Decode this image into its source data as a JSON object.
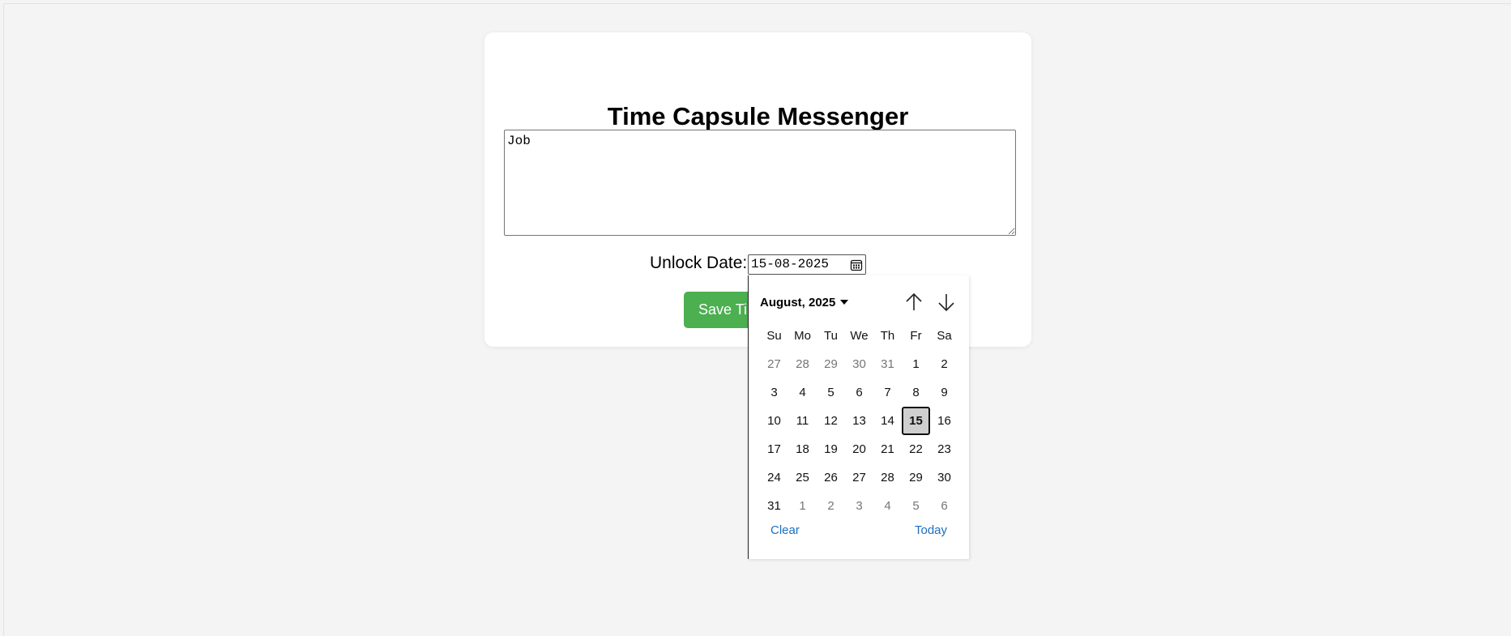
{
  "app": {
    "title": "Time Capsule Messenger"
  },
  "form": {
    "message_value": "Job",
    "unlock_label": "Unlock Date:",
    "date_value": "15-08-2025",
    "save_label": "Save Time Capsule"
  },
  "datepicker": {
    "month_label": "August, 2025",
    "weekdays": [
      "Su",
      "Mo",
      "Tu",
      "We",
      "Th",
      "Fr",
      "Sa"
    ],
    "weeks": [
      [
        {
          "d": "27",
          "other": true
        },
        {
          "d": "28",
          "other": true
        },
        {
          "d": "29",
          "other": true
        },
        {
          "d": "30",
          "other": true
        },
        {
          "d": "31",
          "other": true
        },
        {
          "d": "1"
        },
        {
          "d": "2"
        }
      ],
      [
        {
          "d": "3"
        },
        {
          "d": "4"
        },
        {
          "d": "5"
        },
        {
          "d": "6"
        },
        {
          "d": "7"
        },
        {
          "d": "8"
        },
        {
          "d": "9"
        }
      ],
      [
        {
          "d": "10"
        },
        {
          "d": "11"
        },
        {
          "d": "12"
        },
        {
          "d": "13"
        },
        {
          "d": "14"
        },
        {
          "d": "15",
          "selected": true
        },
        {
          "d": "16"
        }
      ],
      [
        {
          "d": "17"
        },
        {
          "d": "18"
        },
        {
          "d": "19"
        },
        {
          "d": "20"
        },
        {
          "d": "21"
        },
        {
          "d": "22"
        },
        {
          "d": "23"
        }
      ],
      [
        {
          "d": "24"
        },
        {
          "d": "25"
        },
        {
          "d": "26"
        },
        {
          "d": "27"
        },
        {
          "d": "28"
        },
        {
          "d": "29"
        },
        {
          "d": "30"
        }
      ],
      [
        {
          "d": "31"
        },
        {
          "d": "1",
          "other": true
        },
        {
          "d": "2",
          "other": true
        },
        {
          "d": "3",
          "other": true
        },
        {
          "d": "4",
          "other": true
        },
        {
          "d": "5",
          "other": true
        },
        {
          "d": "6",
          "other": true
        }
      ]
    ],
    "clear_label": "Clear",
    "today_label": "Today"
  },
  "colors": {
    "page_bg": "#f4f4f4",
    "card_bg": "#ffffff",
    "button_bg": "#4caf50",
    "link": "#1a6fc2",
    "selected_day_bg": "#cfcfcf"
  }
}
